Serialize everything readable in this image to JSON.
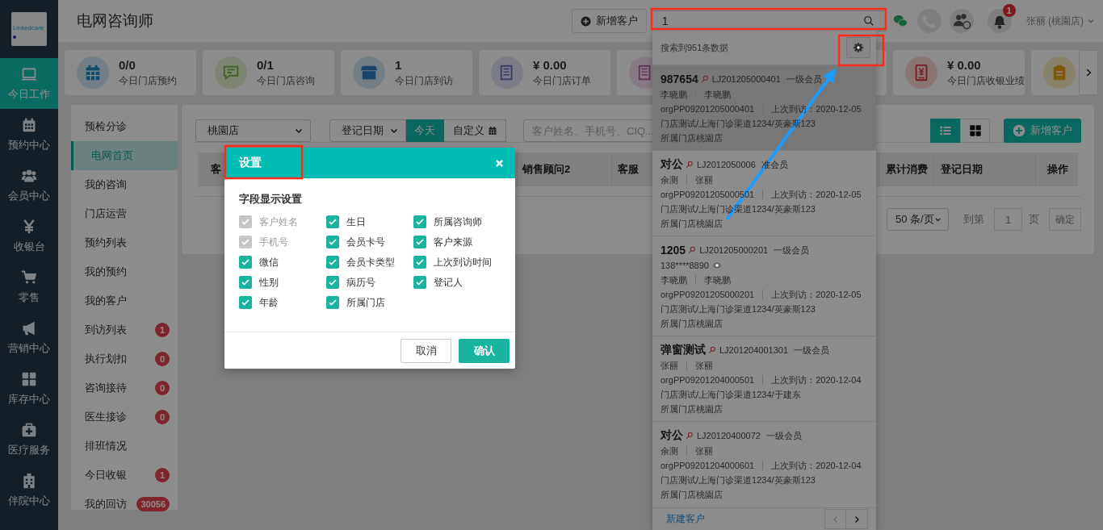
{
  "nav": {
    "logo": "Linkedcare",
    "items": [
      {
        "label": "今日工作",
        "kind": "monitor",
        "selected": true
      },
      {
        "label": "预约中心",
        "kind": "calendar",
        "selected": false
      },
      {
        "label": "会员中心",
        "kind": "users",
        "selected": false
      },
      {
        "label": "收银台",
        "kind": "yen",
        "selected": false
      },
      {
        "label": "零售",
        "kind": "cart",
        "selected": false
      },
      {
        "label": "营销中心",
        "kind": "megaphone",
        "selected": false
      },
      {
        "label": "库存中心",
        "kind": "grid",
        "selected": false
      },
      {
        "label": "医疗服务",
        "kind": "medkit",
        "selected": false
      },
      {
        "label": "伴院中心",
        "kind": "hospital",
        "selected": false
      }
    ]
  },
  "header": {
    "title": "电网咨询师",
    "add_button": "新增客户",
    "search": {
      "value": "1"
    },
    "notifications": "1",
    "user": "张丽 (桃園店)"
  },
  "stats": [
    {
      "kind": "calendar",
      "value": "0/0",
      "label": "今日门店预约"
    },
    {
      "kind": "chat",
      "value": "0/1",
      "label": "今日门店咨询"
    },
    {
      "kind": "store",
      "value": "1",
      "label": "今日门店到访"
    },
    {
      "kind": "news",
      "value": "¥ 0.00",
      "label": "今日门店订单"
    },
    {
      "kind": "report"
    },
    {
      "kind": "blank"
    },
    {
      "kind": "cashier",
      "value": "¥ 0.00",
      "label": "今日门店收银业绩"
    },
    {
      "kind": "clipboard"
    }
  ],
  "submenu": [
    {
      "label": "预检分诊",
      "selected": false
    },
    {
      "label": "电网首页",
      "selected": true
    },
    {
      "label": "我的咨询",
      "selected": false
    },
    {
      "label": "门店运营",
      "selected": false
    },
    {
      "label": "预约列表",
      "selected": false
    },
    {
      "label": "我的预约",
      "selected": false
    },
    {
      "label": "我的客户",
      "selected": false
    },
    {
      "label": "到访列表",
      "selected": false,
      "badge": "1"
    },
    {
      "label": "执行划扣",
      "selected": false,
      "badge": "0"
    },
    {
      "label": "咨询接待",
      "selected": false,
      "badge": "0"
    },
    {
      "label": "医生接诊",
      "selected": false,
      "badge": "0"
    },
    {
      "label": "排班情况",
      "selected": false
    },
    {
      "label": "今日收银",
      "selected": false,
      "badge": "1"
    },
    {
      "label": "我的回访",
      "selected": false,
      "badge": "30056"
    }
  ],
  "filters": {
    "store": "桃園店",
    "date_field": "登记日期",
    "ranges": [
      {
        "label": "今天",
        "selected": true
      },
      {
        "label": "自定义",
        "selected": false
      }
    ],
    "search": {
      "placeholder": "客户姓名、手机号、CIQ..."
    },
    "views": [
      {
        "kind": "list",
        "selected": true
      },
      {
        "kind": "grid",
        "selected": false
      }
    ],
    "add_button": "新增客户"
  },
  "table": {
    "columns": [
      "客",
      "销售顾问2",
      "客服",
      "累计消费",
      "登记日期",
      "操作"
    ]
  },
  "pagination": {
    "page_size": "50 条/页",
    "goto": "到第",
    "page": "1",
    "unit": "页",
    "confirm": "确定"
  },
  "search_results": {
    "summary": "搜索到951条数据",
    "results": [
      {
        "name": "987654",
        "code": "LJ201205000401",
        "level": "一级会员",
        "people": [
          "李晓鹏",
          "李晓鹏"
        ],
        "org": "orgPP09201205000401",
        "last_visit": "上次到访：2020-12-05",
        "address": "门店测试/上海门诊渠道1234/英豪斯123",
        "store": "所属门店桃園店",
        "selected": true
      },
      {
        "name": "对公",
        "code": "LJ2012050006",
        "level": "准会员",
        "people": [
          "余测",
          "张丽"
        ],
        "org": "orgPP09201205000501",
        "last_visit": "上次到访：2020-12-05",
        "address": "门店测试/上海门诊渠道1234/英豪斯123",
        "store": "所属门店桃園店",
        "selected": false
      },
      {
        "name": "1205",
        "code": "LJ201205000201",
        "level": "一级会员",
        "phone": "138****8890",
        "people": [
          "李晓鹏",
          "李晓鹏"
        ],
        "org": "orgPP09201205000201",
        "last_visit": "上次到访：2020-12-05",
        "address": "门店测试/上海门诊渠道1234/英豪斯123",
        "store": "所属门店桃園店",
        "selected": false
      },
      {
        "name": "弹窗测试",
        "code": "LJ201204001301",
        "level": "一级会员",
        "people": [
          "张丽",
          "张丽"
        ],
        "org": "orgPP09201204000501",
        "last_visit": "上次到访：2020-12-04",
        "address": "门店测试/上海门诊渠道1234/于建东",
        "store": "所属门店桃園店",
        "selected": false
      },
      {
        "name": "对公",
        "code": "LJ20120400072",
        "level": "一级会员",
        "people": [
          "余测",
          "张丽"
        ],
        "org": "orgPP09201204000601",
        "last_visit": "上次到访：2020-12-04",
        "address": "门店测试/上海门诊渠道1234/英豪斯123",
        "store": "所属门店桃園店",
        "selected": false
      }
    ],
    "new_link": "新建客户",
    "prev_disabled": true
  },
  "modal": {
    "title": "设置",
    "section": "字段显示设置",
    "fields": [
      {
        "label": "客户姓名",
        "checked": true,
        "disabled": true
      },
      {
        "label": "生日",
        "checked": true,
        "disabled": false
      },
      {
        "label": "所属咨询师",
        "checked": true,
        "disabled": false
      },
      {
        "label": "手机号",
        "checked": true,
        "disabled": true
      },
      {
        "label": "会员卡号",
        "checked": true,
        "disabled": false
      },
      {
        "label": "客户来源",
        "checked": true,
        "disabled": false
      },
      {
        "label": "微信",
        "checked": true,
        "disabled": false
      },
      {
        "label": "会员卡类型",
        "checked": true,
        "disabled": false
      },
      {
        "label": "上次到访时间",
        "checked": true,
        "disabled": false
      },
      {
        "label": "性别",
        "checked": true,
        "disabled": false
      },
      {
        "label": "病历号",
        "checked": true,
        "disabled": false
      },
      {
        "label": "登记人",
        "checked": true,
        "disabled": false
      },
      {
        "label": "年龄",
        "checked": true,
        "disabled": false
      },
      {
        "label": "所属门店",
        "checked": true,
        "disabled": false
      }
    ],
    "buttons": [
      {
        "label": "取消",
        "kind": "secondary"
      },
      {
        "label": "确认",
        "kind": "primary"
      }
    ]
  }
}
